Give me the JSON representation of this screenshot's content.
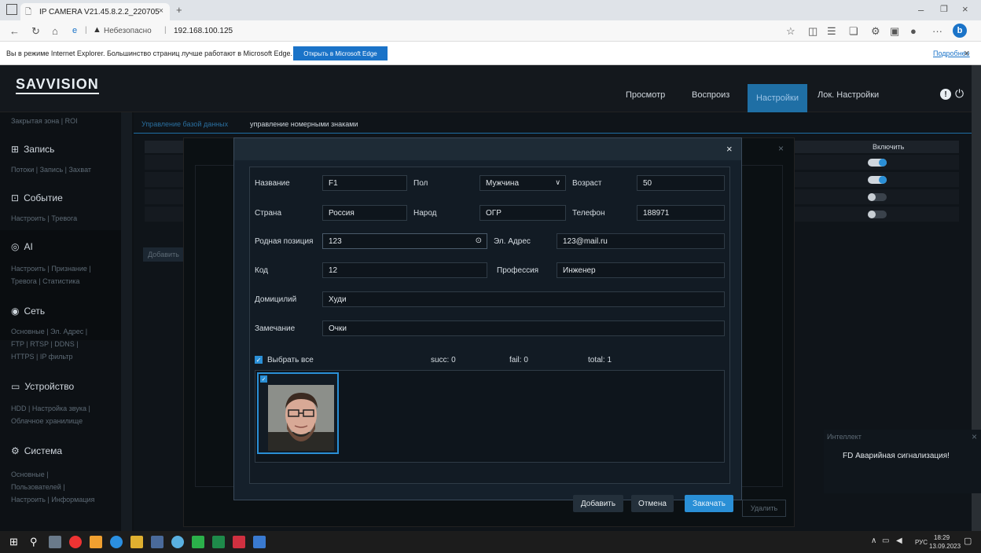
{
  "browser": {
    "tab_title": "IP CAMERA V21.45.8.2.2_220705",
    "address_warn": "Небезопасно",
    "address": "192.168.100.125",
    "info_text": "Вы в режиме Internet Explorer. Большинство страниц лучше работают в Microsoft Edge.",
    "info_button": "Открыть в Microsoft Edge",
    "info_more": "Подробнее",
    "edge_badge": "b"
  },
  "app": {
    "logo": "SAVVISION",
    "nav": [
      "Просмотр",
      "Воспроиз",
      "Настройки",
      "Лок. Настройки"
    ],
    "alert_icon": "!",
    "power_icon": "⏻"
  },
  "sidebar": {
    "top_item": "Закрытая зона | ROI",
    "sections": [
      {
        "title": "Запись",
        "icon": "record-icon",
        "sub": [
          "Потоки | Запись | Захват"
        ]
      },
      {
        "title": "Событие",
        "icon": "event-icon",
        "sub": [
          "Настроить | Тревога"
        ]
      },
      {
        "title": "AI",
        "icon": "ai-icon",
        "sub": [
          "Настроить | Признание |",
          "Тревога | Статистика"
        ]
      },
      {
        "title": "Сеть",
        "icon": "network-icon",
        "sub": [
          "Основные | Эл. Адрес |",
          "FTP | RTSP | DDNS |",
          "HTTPS | IP фильтр"
        ]
      },
      {
        "title": "Устройство",
        "icon": "device-icon",
        "sub": [
          "HDD | Настройка звука |",
          "Облачное хранилище"
        ]
      },
      {
        "title": "Система",
        "icon": "system-icon",
        "sub": [
          "Основные |",
          "Пользователей |",
          "Настроить | Информация"
        ]
      }
    ]
  },
  "main": {
    "tabs": [
      "Управление базой данных",
      "управление номерными знаками"
    ],
    "col_enable": "Включить",
    "add_btn": "Добавить",
    "delete_btn": "Удалить"
  },
  "modal": {
    "close": "×",
    "fields": {
      "name_label": "Название",
      "name": "F1",
      "sex_label": "Пол",
      "sex": "Мужчина",
      "age_label": "Возраст",
      "age": "50",
      "country_label": "Страна",
      "country": "Россия",
      "nation_label": "Народ",
      "nation": "ОГР",
      "phone_label": "Телефон",
      "phone": "188971",
      "native_label": "Родная позиция",
      "native": "123",
      "email_label": "Эл. Адрес",
      "email": "123@mail.ru",
      "code_label": "Код",
      "code": "12",
      "prof_label": "Профессия",
      "prof": "Инженер",
      "dom_label": "Домицилий",
      "dom": "Худи",
      "note_label": "Замечание",
      "note": "Очки"
    },
    "select_all": "Выбрать все",
    "succ": "succ: 0",
    "fail": "fail: 0",
    "total": "total: 1",
    "btn_add": "Добавить",
    "btn_cancel": "Отмена",
    "btn_upload": "Закачать"
  },
  "notification": {
    "title": "Интеллект",
    "text": "FD Аварийная сигнализация!",
    "close": "×"
  },
  "taskbar": {
    "lang": "РУС",
    "time": "18:29",
    "date": "13.09.2023"
  }
}
